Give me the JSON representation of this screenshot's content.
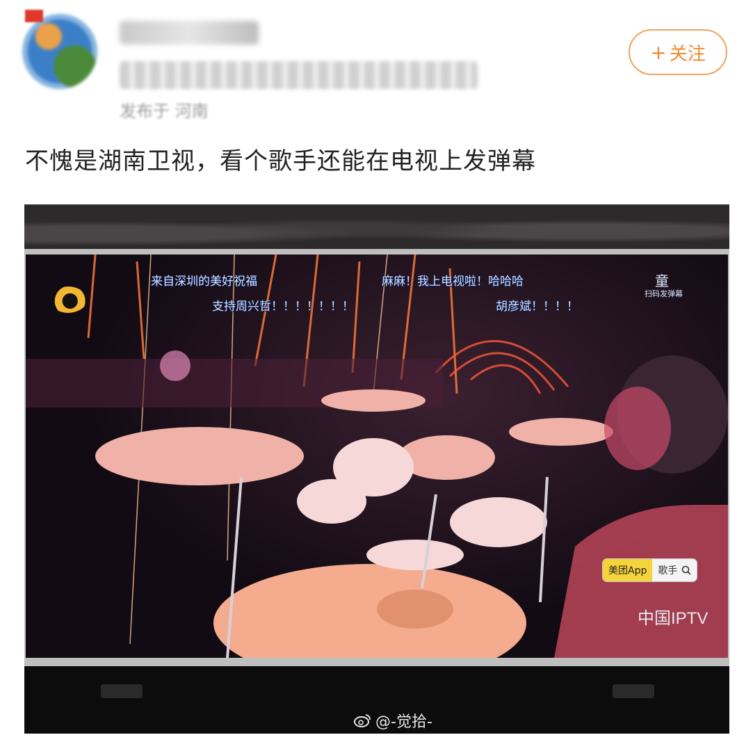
{
  "post": {
    "posted_from": "发布于 河南",
    "follow_label": "关注",
    "follow_plus": "+",
    "text": "不愧是湖南卫视，看个歌手还能在电视上发弹幕"
  },
  "screen": {
    "danmaku": [
      "来自深圳的美好祝福",
      "支持周兴哲！！！！！！！",
      "麻麻！我上电视啦！哈哈哈",
      "胡彦斌！！！！"
    ],
    "corner_char": "童",
    "scan_hint": "扫码发弹幕",
    "ad_left": "美团App",
    "ad_right": "歌手",
    "broadcaster": "中国IPTV"
  },
  "watermark": "@-觉拾-",
  "colors": {
    "accent_orange": "#ee8a2f",
    "danmaku_text": "#cfe2ff",
    "ad_yellow": "#f5d33a"
  }
}
